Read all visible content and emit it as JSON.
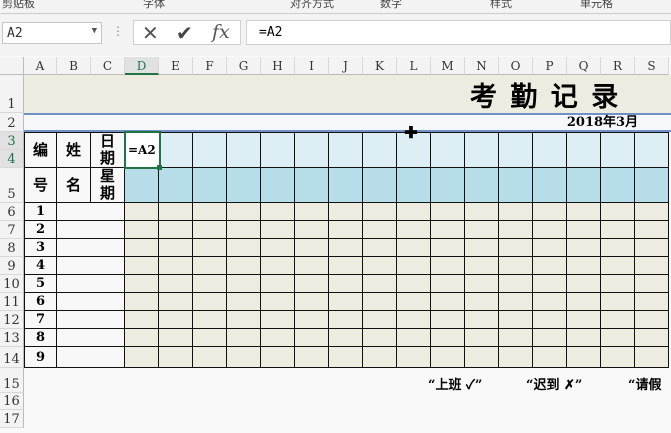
{
  "ribbon_groups": [
    "剪贴板",
    "字体",
    "对齐方式",
    "数字",
    "样式",
    "单元格"
  ],
  "name_box": "A2",
  "formula_bar": {
    "value": "=A2",
    "cancel_icon": "✕",
    "enter_icon": "✔",
    "fx_label": "fx"
  },
  "columns": [
    "A",
    "B",
    "C",
    "D",
    "E",
    "F",
    "G",
    "H",
    "I",
    "J",
    "K",
    "L",
    "M",
    "N",
    "O",
    "P",
    "Q",
    "R",
    "S"
  ],
  "rows": [
    "1",
    "2",
    "3",
    "4",
    "5",
    "6",
    "7",
    "8",
    "9",
    "10",
    "11",
    "12",
    "13",
    "14",
    "15",
    "16",
    "17"
  ],
  "sheet": {
    "title": "考 勤 记 录",
    "month": "2018年3月",
    "hdr_no_top": "编",
    "hdr_name_top": "姓",
    "hdr_date": "日期",
    "hdr_no_bottom": "号",
    "hdr_name_bottom": "名",
    "hdr_weekday": "星期",
    "edit_cell": "=A2",
    "numbers": [
      "1",
      "2",
      "3",
      "4",
      "5",
      "6",
      "7",
      "8",
      "9"
    ],
    "legend": [
      "“上班 ✓”",
      "“迟到 ✗”",
      "“请假"
    ]
  },
  "colors": {
    "header_blue": "#ddeef4",
    "weekday_blue": "#b6dde8",
    "body_beige": "#eeebe0",
    "accent": "#217346"
  }
}
